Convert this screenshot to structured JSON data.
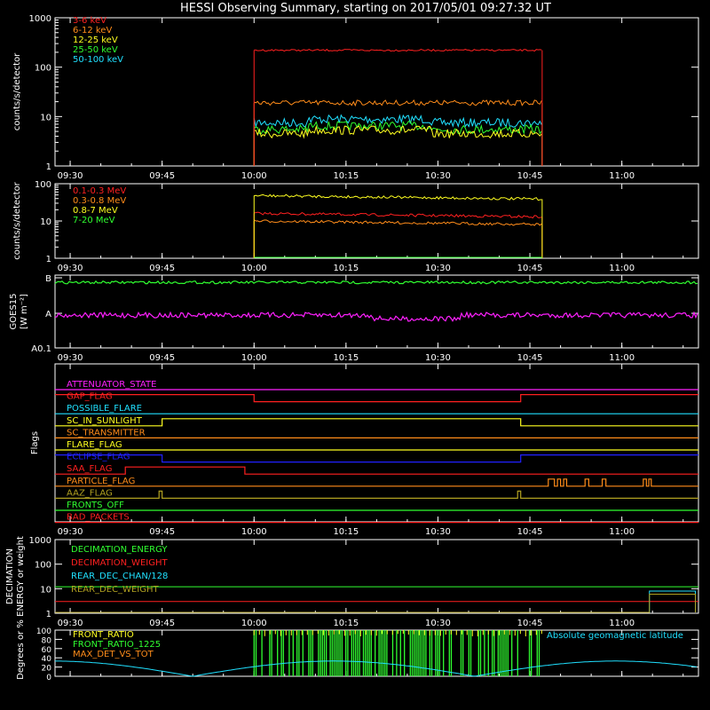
{
  "title": "HESSI Observing Summary, starting on 2017/05/01 09:27:32 UT",
  "time_ticks": [
    "09:30",
    "09:45",
    "10:00",
    "10:15",
    "10:30",
    "10:45",
    "11:00"
  ],
  "time_tick_minutes": [
    30,
    45,
    60,
    75,
    90,
    105,
    120
  ],
  "time_range_minutes": [
    27.53,
    132.5
  ],
  "colors": {
    "red": "#ff2020",
    "orange": "#ff8c1a",
    "yellow": "#ffff20",
    "green": "#30ff30",
    "cyan": "#20e0ff",
    "magenta": "#ff20ff",
    "blue": "#2020ff",
    "olive": "#b0a020",
    "white": "#ffffff"
  },
  "chart_data": [
    {
      "type": "line",
      "ylabel": "counts/s/detector",
      "yscale": "log",
      "ylim": [
        1,
        1000
      ],
      "yticks": [
        "1",
        "10",
        "100",
        "1000"
      ],
      "data_window_minutes": [
        60,
        107
      ],
      "series": [
        {
          "name": "3-6 keV",
          "color": "#ff2020",
          "level": 220
        },
        {
          "name": "6-12 keV",
          "color": "#ff8c1a",
          "level": 19
        },
        {
          "name": "12-25 keV",
          "color": "#ffff20",
          "level": 4.5
        },
        {
          "name": "25-50 keV",
          "color": "#30ff30",
          "level": 5.5
        },
        {
          "name": "50-100 keV",
          "color": "#20e0ff",
          "level": 7.5
        }
      ]
    },
    {
      "type": "line",
      "ylabel": "counts/s/detector",
      "yscale": "log",
      "ylim": [
        1,
        100
      ],
      "yticks": [
        "1",
        "10",
        "100"
      ],
      "data_window_minutes": [
        60,
        107
      ],
      "series": [
        {
          "name": "0.1-0.3 MeV",
          "color": "#ff2020",
          "level": 16
        },
        {
          "name": "0.3-0.8 MeV",
          "color": "#ff8c1a",
          "level": 10
        },
        {
          "name": "0.8-7 MeV",
          "color": "#ffff20",
          "level": 48
        },
        {
          "name": "7-20 MeV",
          "color": "#30ff30",
          "level": 1
        }
      ]
    },
    {
      "type": "line",
      "ylabel": "GOES15",
      "ylabel2": "[W m⁻²]",
      "yticks": [
        "A0.1",
        "A",
        "B"
      ],
      "series": [
        {
          "name": "",
          "color": "#30ff30",
          "level_fraction": 0.9
        },
        {
          "name": "",
          "color": "#ff20ff",
          "level_fraction": 0.45
        }
      ]
    },
    {
      "type": "line",
      "ylabel": "Flags",
      "flags": [
        {
          "name": "ATTENUATOR_STATE",
          "color": "#ff20ff"
        },
        {
          "name": "GAP_FLAG",
          "color": "#ff2020"
        },
        {
          "name": "POSSIBLE_FLARE",
          "color": "#20e0ff"
        },
        {
          "name": "SC_IN_SUNLIGHT",
          "color": "#ffff20"
        },
        {
          "name": "SC_TRANSMITTER",
          "color": "#ff8c1a"
        },
        {
          "name": "FLARE_FLAG",
          "color": "#ffff20"
        },
        {
          "name": "ECLIPSE_FLAG",
          "color": "#2020ff"
        },
        {
          "name": "SAA_FLAG",
          "color": "#ff2020"
        },
        {
          "name": "PARTICLE_FLAG",
          "color": "#ff8c1a"
        },
        {
          "name": "AAZ_FLAG",
          "color": "#b0a020"
        },
        {
          "name": "FRONTS_OFF",
          "color": "#30ff30"
        },
        {
          "name": "BAD_PACKETS",
          "color": "#ff2020"
        }
      ]
    },
    {
      "type": "line",
      "ylabel": "DECIMATION",
      "ylabel2": "ENERGY or weight",
      "yscale": "log",
      "ylim": [
        1,
        1000
      ],
      "yticks": [
        "1",
        "10",
        "100",
        "1000"
      ],
      "series": [
        {
          "name": "DECIMATION_ENERGY",
          "color": "#30ff30",
          "level": 12
        },
        {
          "name": "DECIMATION_WEIGHT",
          "color": "#ff2020",
          "level": 3
        },
        {
          "name": "REAR_DEC_CHAN/128",
          "color": "#20e0ff",
          "level": 8
        },
        {
          "name": "REAR_DEC_WEIGHT",
          "color": "#b0a020",
          "level": 6
        }
      ]
    },
    {
      "type": "line",
      "ylabel": "Degrees or %",
      "ylim": [
        0,
        100
      ],
      "yticks": [
        "0",
        "20",
        "40",
        "60",
        "80",
        "100"
      ],
      "series": [
        {
          "name": "FRONT_RATIO",
          "color": "#ffff20"
        },
        {
          "name": "FRONT_RATIO_1225",
          "color": "#30ff30"
        },
        {
          "name": "MAX_DET_VS_TOT",
          "color": "#ff8c1a"
        },
        {
          "name": "Absolute geomagnetic latitude",
          "color": "#20e0ff"
        }
      ]
    }
  ]
}
